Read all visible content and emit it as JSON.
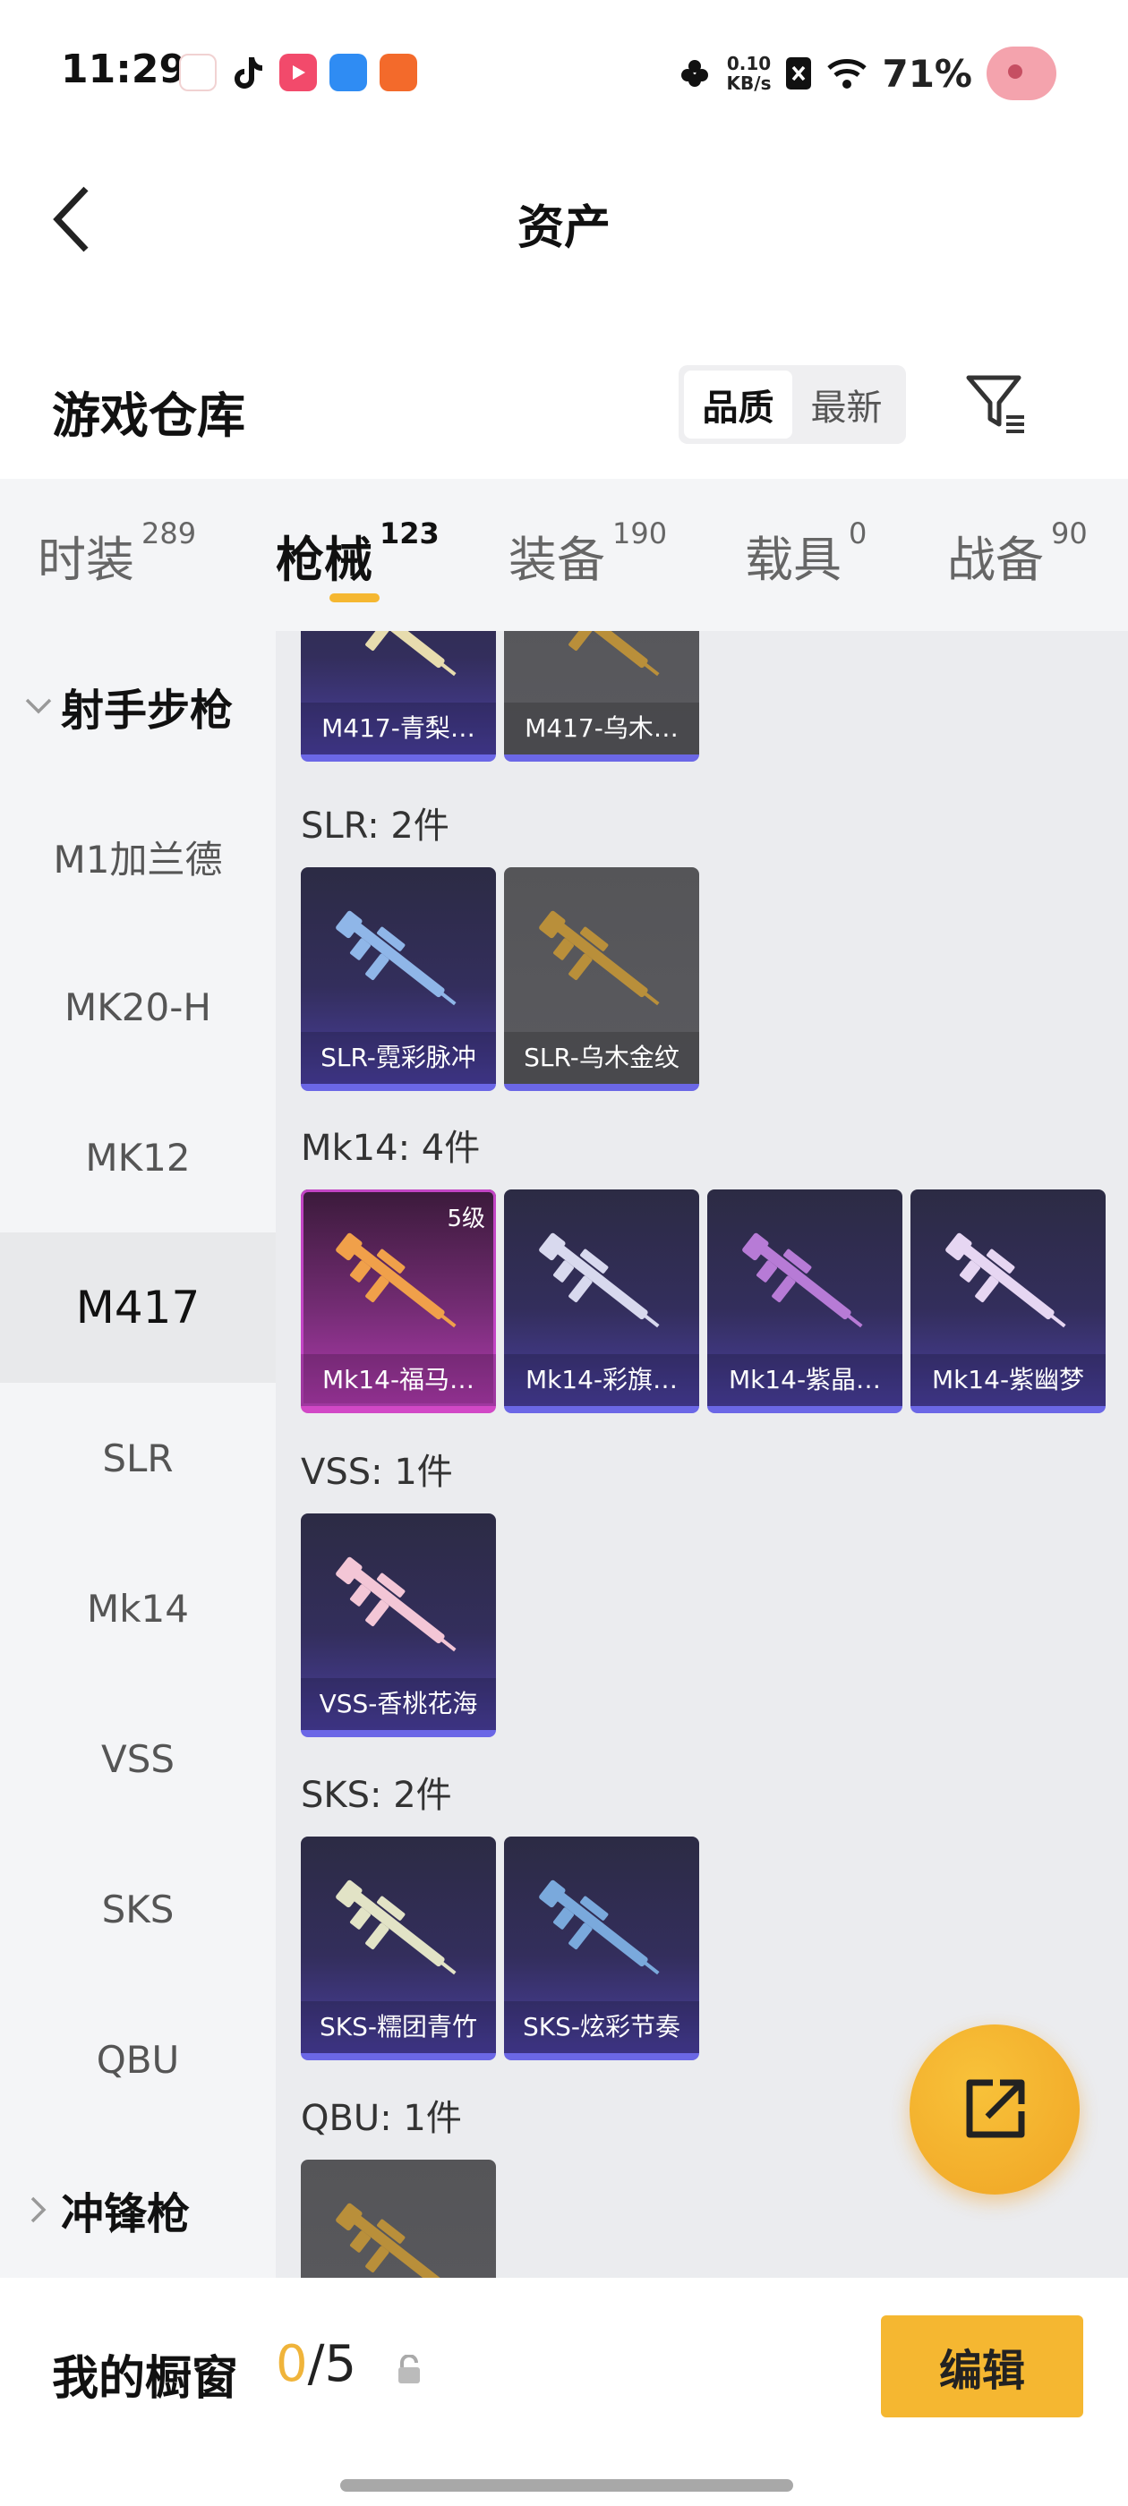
{
  "status_bar": {
    "time": "11:29",
    "net_speed_value": "0.10",
    "net_speed_unit": "KB/s",
    "battery": "71%"
  },
  "header": {
    "title": "资产"
  },
  "warehouse": {
    "title": "游戏仓库",
    "sort_options": [
      "品质",
      "最新"
    ],
    "sort_selected": "品质"
  },
  "tabs": [
    {
      "label": "时装",
      "count": "289"
    },
    {
      "label": "枪械",
      "count": "123"
    },
    {
      "label": "装备",
      "count": "190"
    },
    {
      "label": "载具",
      "count": "0"
    },
    {
      "label": "战备",
      "count": "90"
    }
  ],
  "active_tab": "枪械",
  "sidebar": {
    "group": "射手步枪",
    "items": [
      "M1加兰德",
      "MK20-H",
      "MK12",
      "M417",
      "SLR",
      "Mk14",
      "VSS",
      "SKS",
      "QBU"
    ],
    "active": "M417",
    "next_group": "冲锋枪"
  },
  "sections": [
    {
      "label": "",
      "items": [
        {
          "name": "M417-青梨…",
          "rarity": "purple",
          "gun_color": "#e7dcae"
        },
        {
          "name": "M417-乌木…",
          "rarity": "gray",
          "gun_color": "#b98f3a"
        }
      ]
    },
    {
      "label": "SLR: 2件",
      "items": [
        {
          "name": "SLR-霓彩脉冲",
          "rarity": "purple",
          "gun_color": "#8fb6e8"
        },
        {
          "name": "SLR-乌木金纹",
          "rarity": "gray",
          "gun_color": "#b98f3a"
        }
      ]
    },
    {
      "label": "Mk14: 4件",
      "items": [
        {
          "name": "Mk14-福马…",
          "rarity": "pink",
          "gun_color": "#f0a04a",
          "level": "5级"
        },
        {
          "name": "Mk14-彩旗…",
          "rarity": "purple",
          "gun_color": "#d8d9ee"
        },
        {
          "name": "Mk14-紫晶…",
          "rarity": "purple",
          "gun_color": "#b77bd6"
        },
        {
          "name": "Mk14-紫幽梦",
          "rarity": "purple",
          "gun_color": "#e6d6f2"
        }
      ]
    },
    {
      "label": "VSS: 1件",
      "items": [
        {
          "name": "VSS-香桃花海",
          "rarity": "purple",
          "gun_color": "#f3c6d6"
        }
      ]
    },
    {
      "label": "SKS: 2件",
      "items": [
        {
          "name": "SKS-糯团青竹",
          "rarity": "purple",
          "gun_color": "#e2e3c6"
        },
        {
          "name": "SKS-炫彩节奏",
          "rarity": "purple",
          "gun_color": "#7aa9dc"
        }
      ]
    },
    {
      "label": "QBU: 1件",
      "items": [
        {
          "name": "",
          "rarity": "gray",
          "gun_color": "#b98f3a"
        }
      ]
    }
  ],
  "showcase": {
    "label": "我的橱窗",
    "current": "0",
    "separator_total": "/5",
    "edit_label": "编辑"
  }
}
